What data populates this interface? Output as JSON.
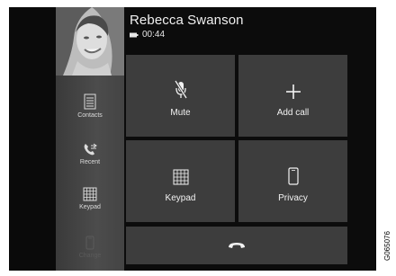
{
  "call": {
    "caller_name": "Rebecca Swanson",
    "duration": "00:44"
  },
  "sidebar": {
    "items": [
      {
        "label": "Contacts",
        "icon": "contacts-icon",
        "enabled": true
      },
      {
        "label": "Recent",
        "icon": "recent-calls-icon",
        "enabled": true
      },
      {
        "label": "Keypad",
        "icon": "keypad-icon",
        "enabled": true
      },
      {
        "label": "Change",
        "icon": "phone-device-icon",
        "enabled": false
      }
    ]
  },
  "actions": {
    "mute_label": "Mute",
    "add_call_label": "Add call",
    "keypad_label": "Keypad",
    "privacy_label": "Privacy"
  },
  "end_call": {
    "icon": "hang-up-icon"
  },
  "figure_code": "G065076",
  "colors": {
    "background": "#0c0c0c",
    "tile": "#3d3d3d",
    "sidebar": "#474747",
    "text": "#f0f0f0"
  }
}
